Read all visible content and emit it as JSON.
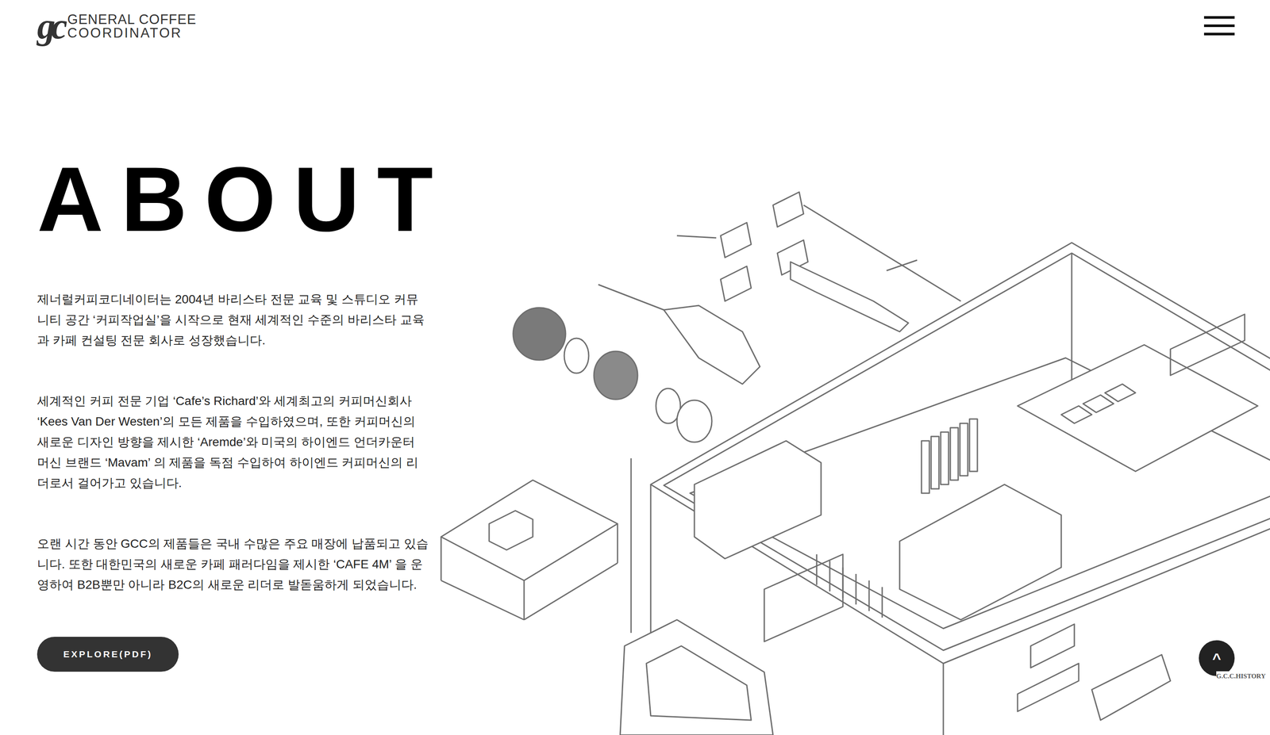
{
  "header": {
    "logo": {
      "mark": "gc",
      "line1": "GENERAL COFFEE",
      "line2": "COORDINATOR"
    }
  },
  "about": {
    "heading": "ABOUT",
    "paragraphs": [
      "제너럴커피코디네이터는 2004년 바리스타 전문 교육 및 스튜디오 커뮤니티 공간 ‘커피작업실’을 시작으로 현재 세계적인 수준의 바리스타 교육과 카페 컨설팅 전문 회사로 성장했습니다.",
      "세계적인 커피 전문 기업 ‘Cafe’s Richard’와 세계최고의 커피머신회사 ‘Kees Van Der Westen’의 모든 제품을 수입하였으며, 또한 커피머신의 새로운 디자인 방향을 제시한 ‘Aremde’와 미국의 하이엔드 언더카운터 머신 브랜드 ‘Mavam’ 의 제품을 독점 수입하여 하이엔드 커피머신의 리더로서 걸어가고 있습니다.",
      "오랜 시간 동안 GCC의 제품들은 국내 수많은 주요 매장에 납품되고 있습니다. 또한 대한민국의 새로운 카페 패러다임을 제시한 ‘CAFE 4M’ 을 운영하여 B2B뿐만 아니라 B2C의 새로운 리더로 발돋움하게 되었습니다."
    ],
    "button": "EXPLORE(PDF)"
  },
  "scroll_top": "^",
  "side_link": "G.C.C.HISTORY"
}
